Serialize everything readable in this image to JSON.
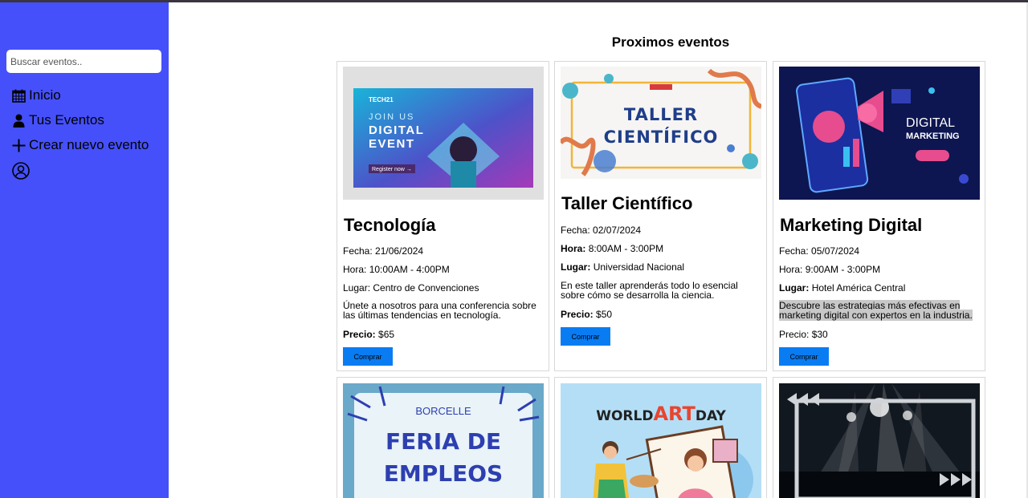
{
  "sidebar": {
    "search_placeholder": "Buscar eventos..",
    "items": [
      {
        "label": "Inicio"
      },
      {
        "label": "Tus Eventos"
      },
      {
        "label": "Crear nuevo evento"
      }
    ]
  },
  "main": {
    "heading": "Proximos eventos",
    "events": [
      {
        "image_title": "JOIN US DIGITAL EVENT",
        "title": "Tecnología",
        "fecha_label": "Fecha:",
        "fecha": "21/06/2024",
        "hora_label": "Hora:",
        "hora": "10:00AM - 4:00PM",
        "lugar_label": "Lugar:",
        "lugar": "Centro de Convenciones",
        "description": "Únete a nosotros para una conferencia sobre las últimas tendencias en tecnología.",
        "precio_label": "Precio:",
        "precio": "$65",
        "button": "Comprar"
      },
      {
        "image_title": "TALLER CIENTÍFICO",
        "title": "Taller Científico",
        "fecha_label": "Fecha:",
        "fecha": "02/07/2024",
        "hora_label": "Hora:",
        "hora": "8:00AM - 3:00PM",
        "lugar_label": "Lugar:",
        "lugar": "Universidad Nacional",
        "description": "En este taller aprenderás todo lo esencial sobre cómo se desarrolla la ciencia.",
        "precio_label": "Precio:",
        "precio": "$50",
        "button": "Comprar"
      },
      {
        "image_title": "DIGITAL MARKETING",
        "title": "Marketing Digital",
        "fecha_label": "Fecha:",
        "fecha": "05/07/2024",
        "hora_label": "Hora:",
        "hora": "9:00AM - 3:00PM",
        "lugar_label": "Lugar:",
        "lugar": "Hotel América Central",
        "description": "Descubre las estrategias más efectivas en marketing digital con expertos en la industria.",
        "precio_label": "Precio:",
        "precio": "$30",
        "button": "Comprar"
      },
      {
        "image_brand": "BORCELLE",
        "image_title_1": "FERIA DE",
        "image_title_2": "EMPLEOS"
      },
      {
        "image_title_a": "WORLD",
        "image_title_b": "ART",
        "image_title_c": "DAY"
      },
      {}
    ]
  },
  "colors": {
    "sidebar": "#4550fa",
    "button": "#0a7cf2",
    "highlight": "#c8c8c8"
  },
  "icons": [
    "calendar-icon",
    "user-icon",
    "plus-icon",
    "account-circle-icon"
  ]
}
